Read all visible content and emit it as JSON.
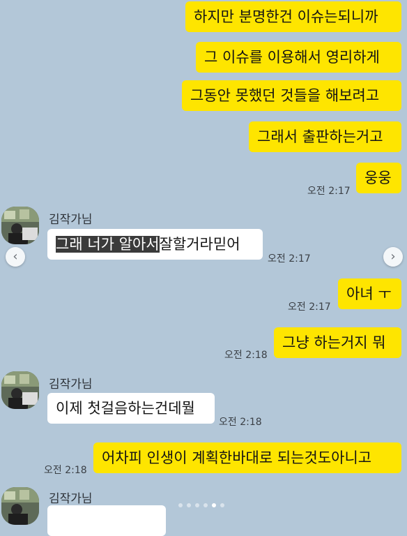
{
  "messages": [
    {
      "text": "하지만 분명한건 이슈는되니까",
      "side": "me"
    },
    {
      "text": "그 이슈를 이용해서 영리하게",
      "side": "me"
    },
    {
      "text": "그동안 못했던 것들을 해보려고",
      "side": "me"
    },
    {
      "text": "그래서 출판하는거고",
      "side": "me"
    },
    {
      "text": "웅웅",
      "side": "me",
      "time": "오전 2:17"
    },
    {
      "sender": "김작가님",
      "text_highlighted": "그래 너가 알아서",
      "text_rest": "잘할거라믿어",
      "side": "you",
      "time": "오전 2:17"
    },
    {
      "text": "아녀 ㅜ",
      "side": "me",
      "time": "오전 2:17"
    },
    {
      "text": "그냥 하는거지 뭐",
      "side": "me",
      "time": "오전 2:18"
    },
    {
      "sender": "김작가님",
      "text": "이제 첫걸음하는건데뭘",
      "side": "you",
      "time": "오전 2:18"
    },
    {
      "text": "어차피 인생이 계획한바대로 되는것도아니고",
      "side": "me",
      "time": "오전 2:18"
    },
    {
      "sender": "김작가님",
      "side": "you"
    }
  ],
  "carousel": {
    "prev_icon": "chevron-left-icon",
    "next_icon": "chevron-right-icon",
    "total_slides": 6,
    "active_slide": 4
  },
  "colors": {
    "background": "#b3c7d8",
    "my_bubble": "#fee500",
    "their_bubble": "#ffffff"
  }
}
